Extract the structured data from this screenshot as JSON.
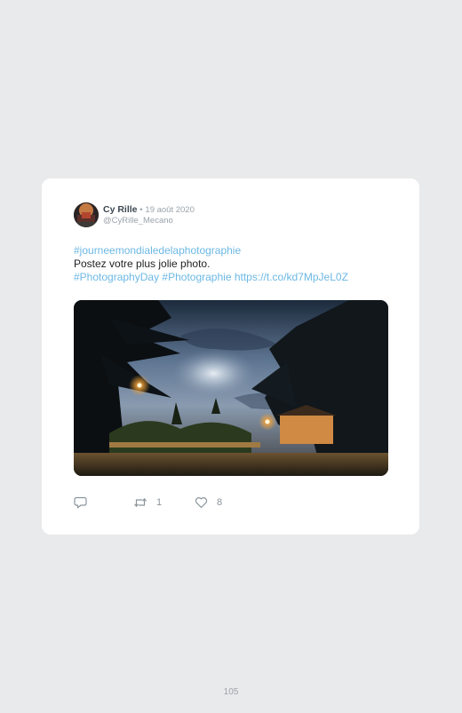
{
  "tweet": {
    "display_name": "Cy Rille",
    "separator": "•",
    "date": "19 août 2020",
    "handle": "@CyRille_Mecano",
    "hashtag_1": "#journeemondialedelaphotographie",
    "text_line": "Postez votre plus jolie photo.",
    "hashtag_2": "#PhotographyDay",
    "hashtag_3": "#Photographie",
    "link": "https://t.co/kd7MpJeL0Z",
    "avatar_icon": "profile-photo",
    "media_description_icon": "night-garden-photo"
  },
  "actions": {
    "reply": {
      "icon": "reply-icon",
      "count": ""
    },
    "retweet": {
      "icon": "retweet-icon",
      "count": "1"
    },
    "like": {
      "icon": "heart-icon",
      "count": "8"
    }
  },
  "colors": {
    "background": "#e9eaeb",
    "card": "#ffffff",
    "link": "#6cb8e4",
    "muted": "#9aa3ab"
  },
  "footer": {
    "page_number": "105"
  }
}
